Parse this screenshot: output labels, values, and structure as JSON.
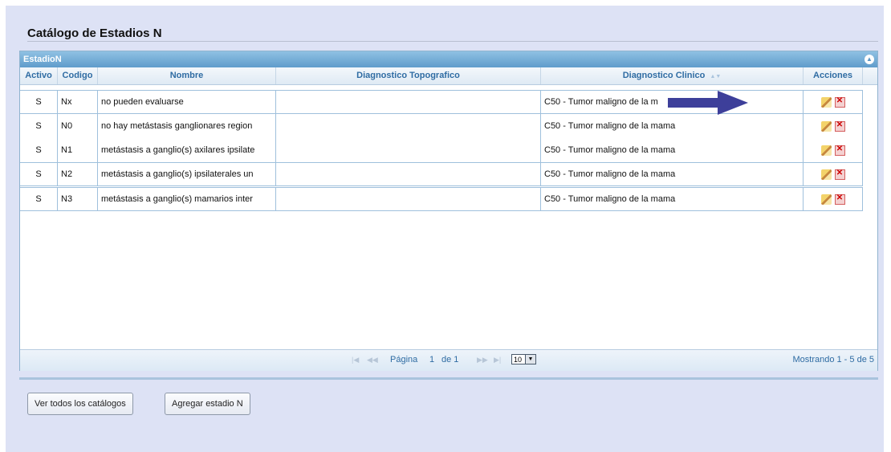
{
  "page": {
    "title": "Catálogo de Estadios N"
  },
  "grid": {
    "caption": "EstadioN",
    "columns": [
      "Activo",
      "Codigo",
      "Nombre",
      "Diagnostico Topografico",
      "Diagnostico Clinico",
      "Acciones"
    ],
    "sort_indicator": "▲▼",
    "rows": [
      {
        "activo": "S",
        "codigo": "Nx",
        "nombre": "no pueden evaluarse",
        "topografico": "",
        "clinico": "C50 - Tumor maligno de la m"
      },
      {
        "activo": "S",
        "codigo": "N0",
        "nombre": "no hay metástasis ganglionares region",
        "topografico": "",
        "clinico": "C50 - Tumor maligno de la mama"
      },
      {
        "activo": "S",
        "codigo": "N1",
        "nombre": "metástasis a ganglio(s) axilares ipsilate",
        "topografico": "",
        "clinico": "C50 - Tumor maligno de la mama"
      },
      {
        "activo": "S",
        "codigo": "N2",
        "nombre": "metástasis a ganglio(s) ipsilaterales un",
        "topografico": "",
        "clinico": "C50 - Tumor maligno de la mama"
      },
      {
        "activo": "S",
        "codigo": "N3",
        "nombre": "metástasis a ganglio(s) mamarios inter",
        "topografico": "",
        "clinico": "C50 - Tumor maligno de la mama"
      }
    ],
    "pager": {
      "first": "|◀",
      "prev": "◀◀",
      "page_label": "Página",
      "page": "1",
      "of_label": "de 1",
      "next": "▶▶",
      "last": "▶|",
      "rows_per_page": "10",
      "info": "Mostrando 1 - 5 de 5"
    },
    "icons": {
      "edit": "pencil-edit-icon",
      "delete": "delete-icon",
      "collapse": "collapse-icon"
    }
  },
  "overlay": {
    "arrow_color": "#3d3f9a"
  },
  "buttons": {
    "view_all": "Ver todos los catálogos",
    "add": "Agregar estadio N"
  },
  "colors": {
    "background": "#dde2f5",
    "header_text": "#2f6ca3",
    "caption_bar": "#6ea9d4"
  }
}
